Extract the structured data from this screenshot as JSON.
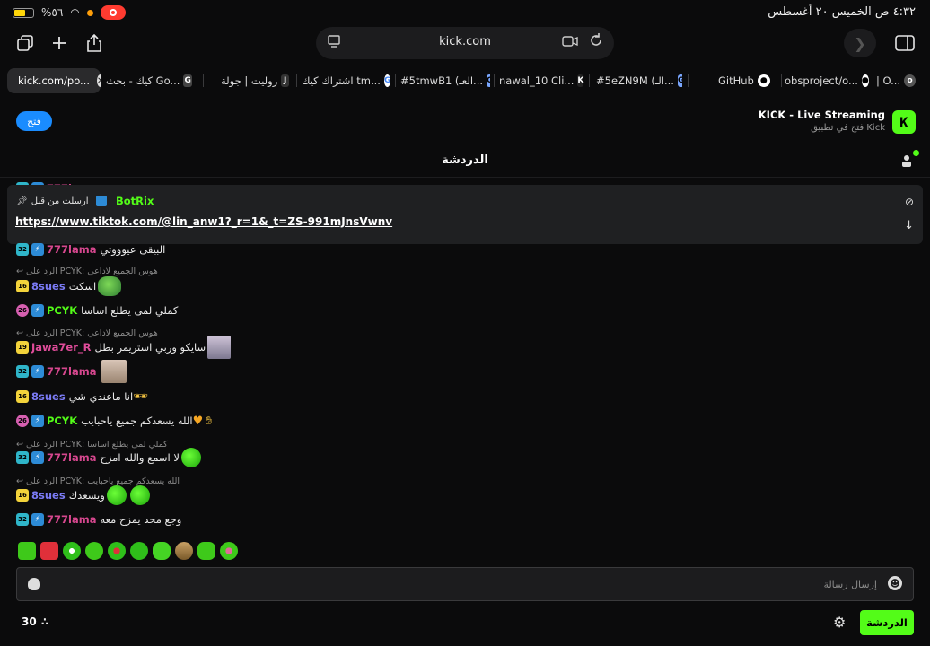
{
  "status": {
    "battery_percent": "%٥٦",
    "battery_fill": 0.56,
    "datetime": "٤:٣٢ ص  الخميس ٢٠ أغسطس"
  },
  "toolbar": {
    "url": "kick.com",
    "icons": [
      "tabs-icon",
      "plus-icon",
      "share-icon",
      "reader-icon",
      "translate-icon",
      "reload-icon",
      "forward-icon",
      "sidebar-icon"
    ]
  },
  "tabs": [
    {
      "label": "kick.com/po...",
      "fav": ""
    },
    {
      "label": "كيك - بحث Go...",
      "fav": "G"
    },
    {
      "label": "روليت | جولة",
      "fav": "J"
    },
    {
      "label": "اشتراك كيك tm...",
      "fav": "G"
    },
    {
      "label": "#5tmwB1 (العـ...",
      "fav": "G"
    },
    {
      "label": "nawal_10 Cli...",
      "fav": "K"
    },
    {
      "label": "#5eZN9M (الـ...",
      "fav": "G"
    },
    {
      "label": "GitHub",
      "fav": "gh"
    },
    {
      "label": "obsproject/o...",
      "fav": "gh"
    },
    {
      "label": "| O...",
      "fav": "o"
    }
  ],
  "banner": {
    "open_label": "فتح",
    "title": "KICK - Live Streaming",
    "subtitle": "فتح في تطبيق Kick",
    "logo": "K"
  },
  "chat": {
    "title": "الدردشة",
    "pinned": {
      "label": "ارسلت من قبل",
      "user": "BotRix",
      "link": "https://www.tiktok.com/@lin_anw1?_r=1&_t=ZS-991mJnsVwnv"
    },
    "partial_top_user": "777lama",
    "messages": [
      {
        "badge": "32",
        "user": "777lama",
        "text": "البيقى عيوووتي",
        "color": "pink"
      },
      {
        "reply": "الرد على PCYK: هوس الجميع لاداعي"
      },
      {
        "badge": "16",
        "user": "8sues",
        "text": "اسكت",
        "color": "blue"
      },
      {
        "badge": "26",
        "user": "PCYK",
        "text": "كملي لمى يطلع اساسا",
        "color": "green"
      },
      {
        "reply": "الرد على PCYK: هوس الجميع لاداعي"
      },
      {
        "badge": "19",
        "user": "Jawa7er_R",
        "text": "سايكو وربي استريمر بطل",
        "color": "mag"
      },
      {
        "badge": "32",
        "user": "777lama",
        "text": "",
        "color": "pink"
      },
      {
        "badge": "16",
        "user": "8sues",
        "text": "انا ماعندي شي",
        "color": "blue"
      },
      {
        "badge": "26",
        "user": "PCYK",
        "text": "الله يسعدكم جميع ياحبايب",
        "color": "green"
      },
      {
        "reply": "الرد على PCYK: كملي لمى يطلع اساسا"
      },
      {
        "badge": "32",
        "user": "777lama",
        "text": "لا اسمع والله امزح",
        "color": "pink"
      },
      {
        "reply": "الرد على PCYK: الله يسعدكم جميع ياحبايب"
      },
      {
        "badge": "16",
        "user": "8sues",
        "text": "ويسعدك",
        "color": "blue"
      },
      {
        "badge": "32",
        "user": "777lama",
        "text": "وجع محد يمزح معه",
        "color": "pink"
      }
    ],
    "input_placeholder": "إرسال رسالة",
    "viewers": "30",
    "send_label": "الدردشة"
  },
  "colors": {
    "accent": "#53fc18",
    "link_button": "#1a8cff",
    "background": "#0b0b0c"
  }
}
